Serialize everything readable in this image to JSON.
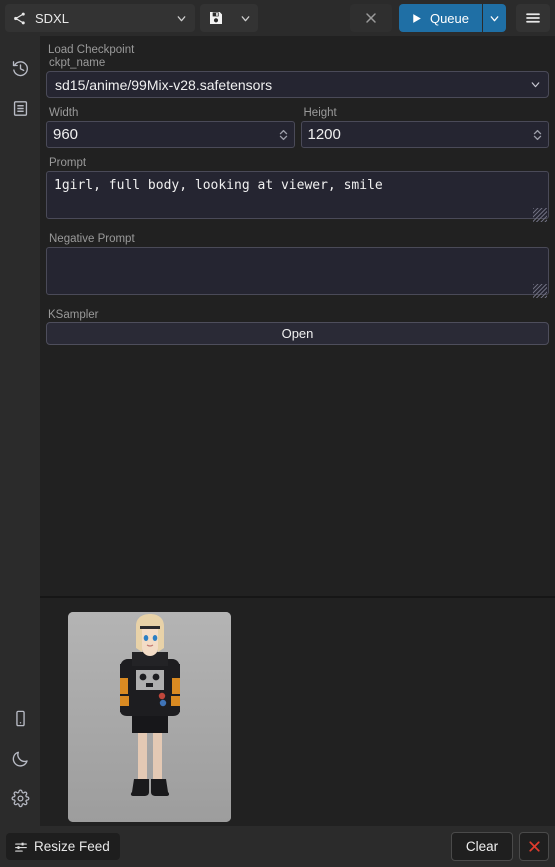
{
  "topbar": {
    "workflow_icon": "workflow-nodes-icon",
    "workflow_name": "SDXL",
    "workflow_caret_icon": "chevron-down-icon",
    "save_icon": "save-floppy-icon",
    "save_caret_icon": "chevron-down-icon",
    "close_icon": "close-x-icon",
    "queue_label": "Queue",
    "queue_play_icon": "play-triangle-icon",
    "queue_caret_icon": "chevron-down-icon",
    "menu_icon": "hamburger-menu-icon",
    "accent_color": "#1f6fa5"
  },
  "rail": {
    "top_items": [
      {
        "name": "history-icon",
        "label": "History"
      },
      {
        "name": "queue-list-icon",
        "label": "Queue"
      }
    ],
    "bottom_items": [
      {
        "name": "mobile-device-icon",
        "label": "Mobile View"
      },
      {
        "name": "moon-icon",
        "label": "Theme"
      },
      {
        "name": "gear-icon",
        "label": "Settings"
      }
    ]
  },
  "form": {
    "load_checkpoint": {
      "group_title": "Load Checkpoint",
      "ckpt_label": "ckpt_name",
      "ckpt_value": "sd15/anime/99Mix-v28.safetensors",
      "caret_icon": "chevron-down-icon"
    },
    "dimensions": {
      "width_label": "Width",
      "width_value": "960",
      "height_label": "Height",
      "height_value": "1200",
      "stepper_icon": "stepper-up-down-icon"
    },
    "prompt": {
      "label": "Prompt",
      "value": "1girl, full body, looking at viewer, smile",
      "placeholder": ""
    },
    "negative_prompt": {
      "label": "Negative Prompt",
      "value": "",
      "placeholder": ""
    },
    "ksampler": {
      "group_title": "KSampler",
      "open_label": "Open"
    }
  },
  "feed": {
    "items": [
      {
        "name": "generated-image",
        "alt": "anime girl full body, black hoodie with skull print, black shorts, boots, grey background"
      }
    ]
  },
  "bottombar": {
    "resize_feed_label": "Resize Feed",
    "resize_feed_icon": "resize-sliders-icon",
    "clear_label": "Clear",
    "close_icon": "close-x-icon",
    "close_color": "#e03c2d"
  }
}
